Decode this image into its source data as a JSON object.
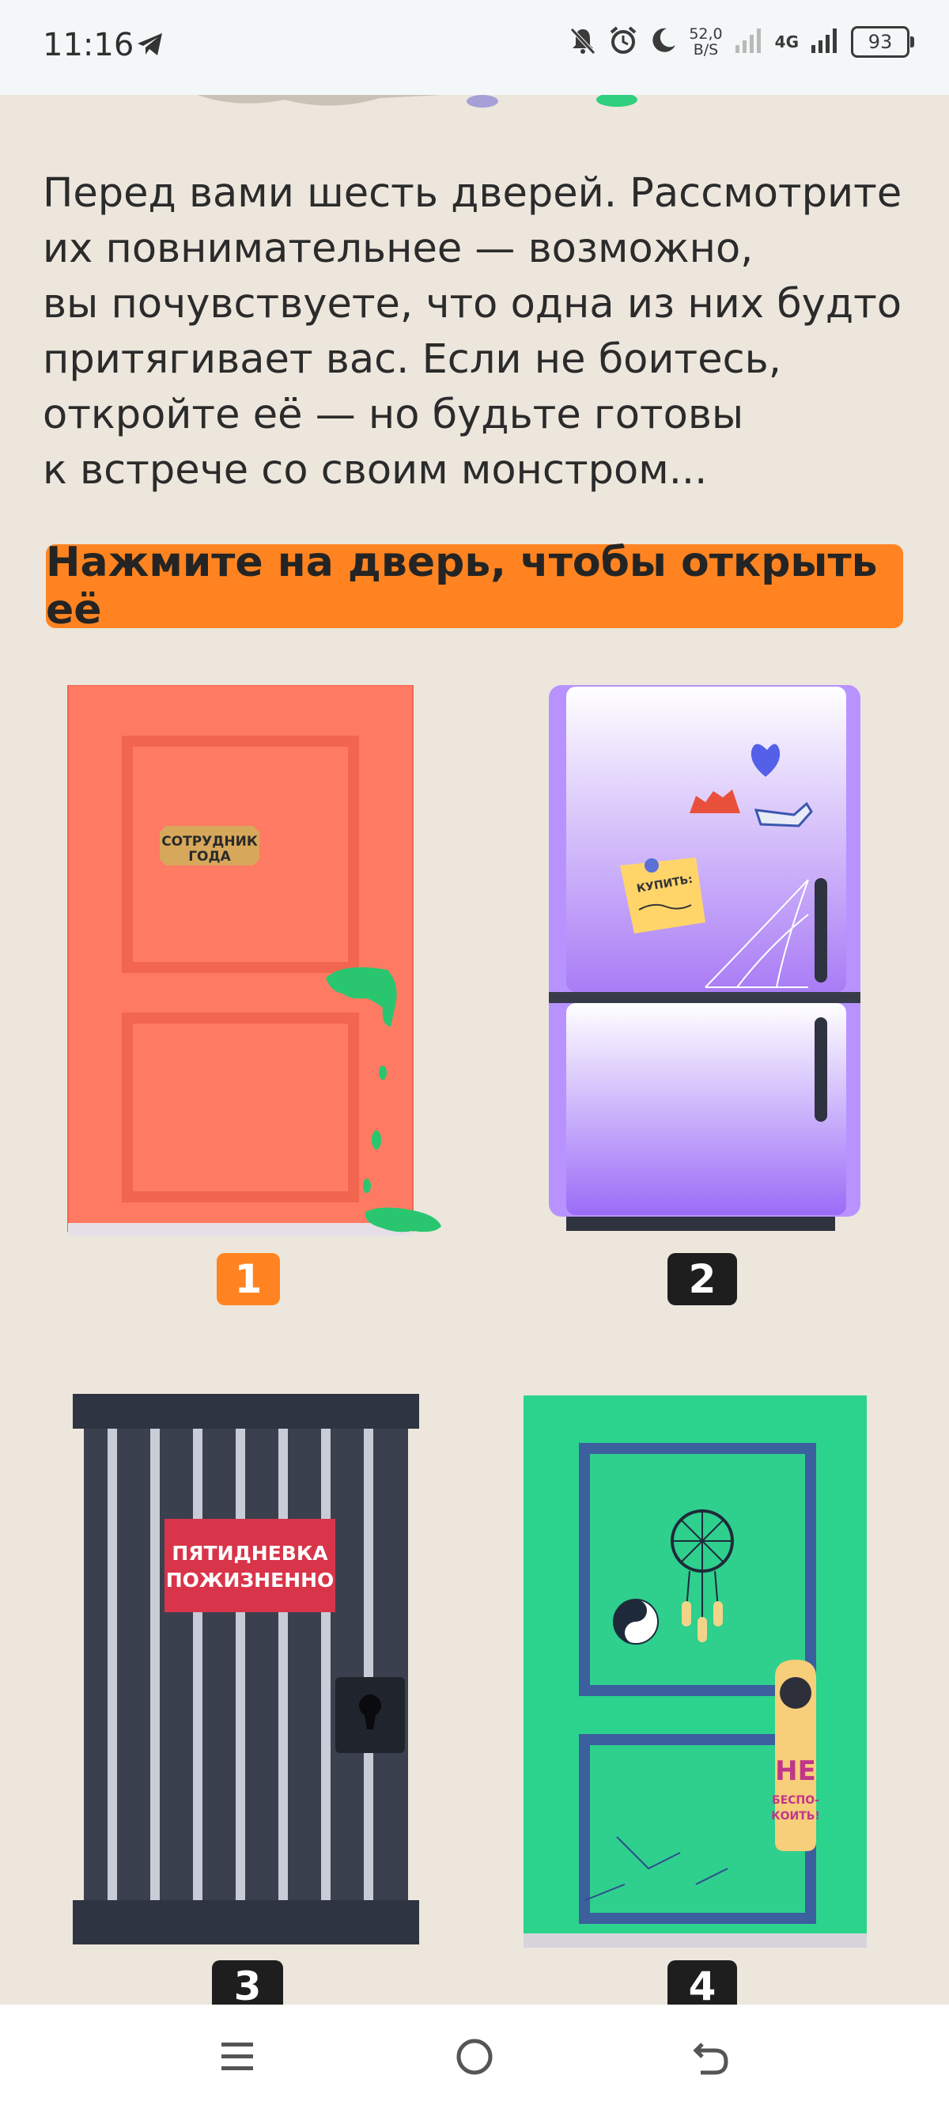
{
  "status_bar": {
    "time": "11:16",
    "net_speed_value": "52,0",
    "net_speed_unit": "B/S",
    "network": "4G",
    "battery": "93"
  },
  "intro_text": "Перед вами шесть дверей. Рассмотрите\nих повнимательнее — возможно,\nвы почувствуете, что одна из них будто\nпритягивает вас. Если не боитесь,\nоткройте её — но будьте готовы\nк встрече со своим монстром...",
  "cta_label": "Нажмите на дверь, чтобы открыть её",
  "doors": [
    {
      "number": "1",
      "sign_line1": "СОТРУДНИК",
      "sign_line2": "ГОДА",
      "badge_color": "#ff8421"
    },
    {
      "number": "2",
      "note_text": "КУПИТЬ:",
      "badge_color": "#1e1e1e"
    },
    {
      "number": "3",
      "sign_line1": "ПЯТИДНЕВКА",
      "sign_line2": "ПОЖИЗНЕННО",
      "badge_color": "#1e1e1e"
    },
    {
      "number": "4",
      "hanger_line1": "НЕ",
      "hanger_line2": "БЕСПО-",
      "hanger_line3": "КОИТЬ!",
      "badge_color": "#1e1e1e"
    }
  ],
  "nav": {
    "menu_icon": "menu-icon",
    "home_icon": "home-icon",
    "back_icon": "back-icon"
  }
}
